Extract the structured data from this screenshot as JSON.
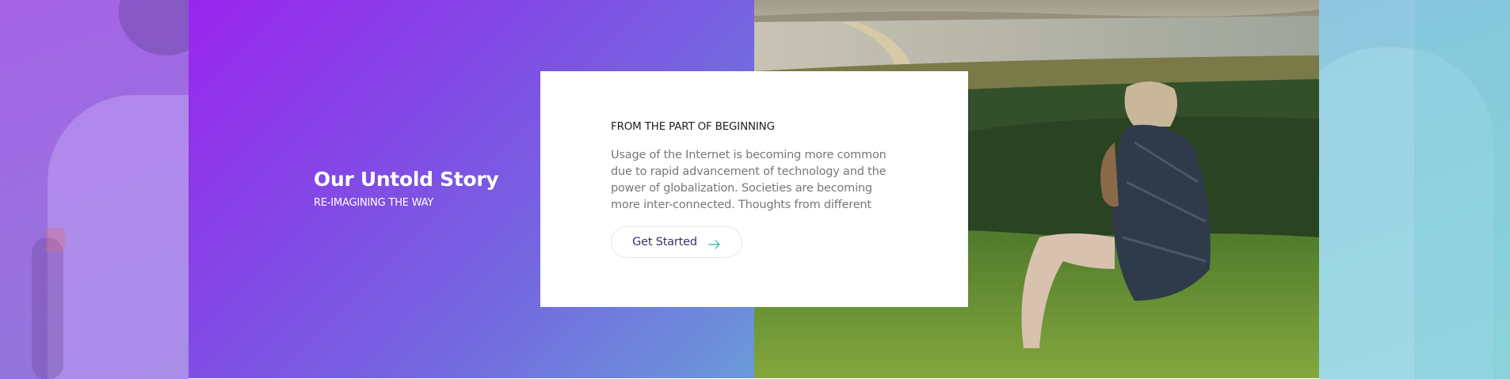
{
  "hero": {
    "title": "Our Untold Story",
    "subtitle": "RE-IMAGINING THE WAY"
  },
  "card": {
    "eyebrow": "FROM THE PART OF BEGINNING",
    "body": "Usage of the Internet is becoming more common due to rapid advancement of technology and the power of globalization. Societies are becoming more inter-connected. Thoughts from different",
    "cta_label": "Get Started",
    "cta_icon": "arrow-right-icon"
  },
  "colors": {
    "gradient_start": "#9a25ee",
    "gradient_end": "#6a9ad8",
    "cta_text": "#3b2f6b",
    "cta_arrow": "#3ec5a8"
  }
}
